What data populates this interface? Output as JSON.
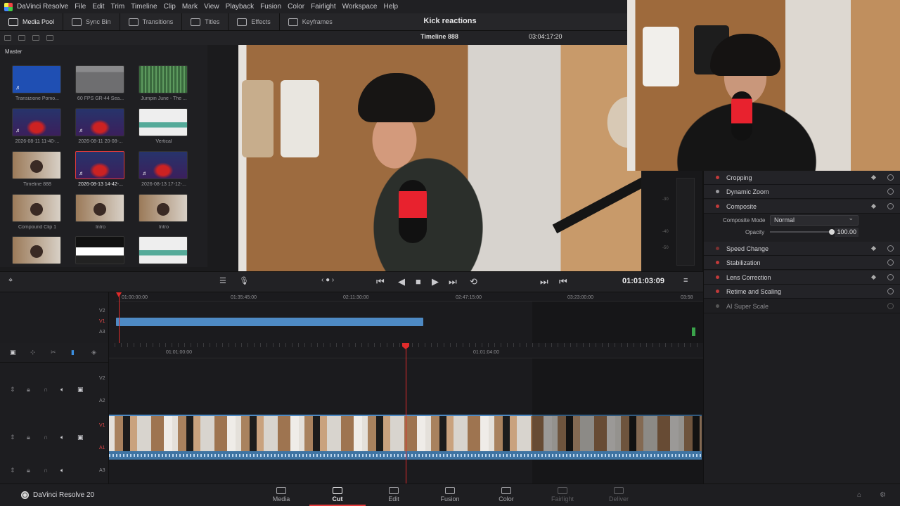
{
  "app": {
    "name": "DaVinci Resolve",
    "version_label": "DaVinci Resolve 20",
    "project_title": "Kick reactions"
  },
  "menu": [
    "File",
    "Edit",
    "Trim",
    "Timeline",
    "Clip",
    "Mark",
    "View",
    "Playback",
    "Fusion",
    "Color",
    "Fairlight",
    "Workspace",
    "Help"
  ],
  "toolbar": [
    {
      "label": "Media Pool",
      "active": true,
      "icon": "media-pool-icon"
    },
    {
      "label": "Sync Bin",
      "active": false,
      "icon": "sync-bin-icon"
    },
    {
      "label": "Transitions",
      "active": false,
      "icon": "transitions-icon"
    },
    {
      "label": "Titles",
      "active": false,
      "icon": "titles-icon"
    },
    {
      "label": "Effects",
      "active": false,
      "icon": "effects-icon"
    },
    {
      "label": "Keyframes",
      "active": false,
      "icon": "keyframes-icon"
    }
  ],
  "media_pool": {
    "bin": "Master",
    "clips": [
      {
        "label": "Transizione Pomo...",
        "thumb": "t-blue",
        "audio": true
      },
      {
        "label": "60 FPS GR-44 Sea...",
        "thumb": "t-folder",
        "audio": false
      },
      {
        "label": "Jumpin June - The ...",
        "thumb": "t-green",
        "audio": false
      },
      {
        "label": "2026-08-11 11-40-...",
        "thumb": "t-stage",
        "audio": true
      },
      {
        "label": "2026-08-11 20-08-...",
        "thumb": "t-stage",
        "audio": true
      },
      {
        "label": "Vertical",
        "thumb": "t-white",
        "audio": false
      },
      {
        "label": "Timeline 888",
        "thumb": "t-face",
        "audio": false
      },
      {
        "label": "2026-08-13 14-42-...",
        "thumb": "t-stage",
        "audio": true,
        "selected": true
      },
      {
        "label": "2026-08-13 17-12-...",
        "thumb": "t-stage",
        "audio": true
      },
      {
        "label": "Compound Clip 1",
        "thumb": "t-face",
        "audio": false
      },
      {
        "label": "Intro",
        "thumb": "t-face",
        "audio": false
      },
      {
        "label": "Intro",
        "thumb": "t-face",
        "audio": false
      },
      {
        "label": "",
        "thumb": "t-face",
        "audio": false
      },
      {
        "label": "",
        "thumb": "t-dark",
        "audio": false
      },
      {
        "label": "",
        "thumb": "t-white",
        "audio": false
      }
    ]
  },
  "viewer": {
    "timeline_name": "Timeline 888",
    "duration_tc": "03:04:17:20"
  },
  "inspector": {
    "sections": [
      {
        "label": "Cropping",
        "enabled": true,
        "keyframe": true
      },
      {
        "label": "Dynamic Zoom",
        "enabled": false,
        "keyframe": false
      },
      {
        "label": "Composite",
        "enabled": true,
        "keyframe": true
      },
      {
        "label": "Speed Change",
        "enabled": true,
        "keyframe": true
      },
      {
        "label": "Stabilization",
        "enabled": true,
        "keyframe": false
      },
      {
        "label": "Lens Correction",
        "enabled": true,
        "keyframe": true
      },
      {
        "label": "Retime and Scaling",
        "enabled": true,
        "keyframe": false
      },
      {
        "label": "AI Super Scale",
        "enabled": false,
        "keyframe": false
      }
    ],
    "composite_mode_label": "Composite Mode",
    "composite_mode_value": "Normal",
    "opacity_label": "Opacity",
    "opacity_value": "100.00"
  },
  "meter_scale": [
    "-30",
    "-40",
    "-50"
  ],
  "transport": {
    "timecode": "01:01:03:09"
  },
  "upper_timeline": {
    "ruler": [
      "01:00:00:00",
      "01:35:45:00",
      "02:11:30:00",
      "02:47:15:00",
      "03:23:00:00",
      "03:58"
    ],
    "tracks": [
      "V2",
      "V1",
      "A3"
    ]
  },
  "lower_timeline": {
    "ruler": [
      "01:01:00:00",
      "01:01:04:00"
    ],
    "tracks": [
      "V2",
      "A2",
      "V1",
      "A1",
      "A3"
    ]
  },
  "pages": [
    {
      "label": "Media",
      "state": "normal"
    },
    {
      "label": "Cut",
      "state": "active"
    },
    {
      "label": "Edit",
      "state": "normal"
    },
    {
      "label": "Fusion",
      "state": "normal"
    },
    {
      "label": "Color",
      "state": "normal"
    },
    {
      "label": "Fairlight",
      "state": "dim"
    },
    {
      "label": "Deliver",
      "state": "dim"
    }
  ],
  "colors": {
    "accent": "#e23a3a",
    "clip_blue": "#4e8ac4",
    "background": "#1b1b1d"
  }
}
